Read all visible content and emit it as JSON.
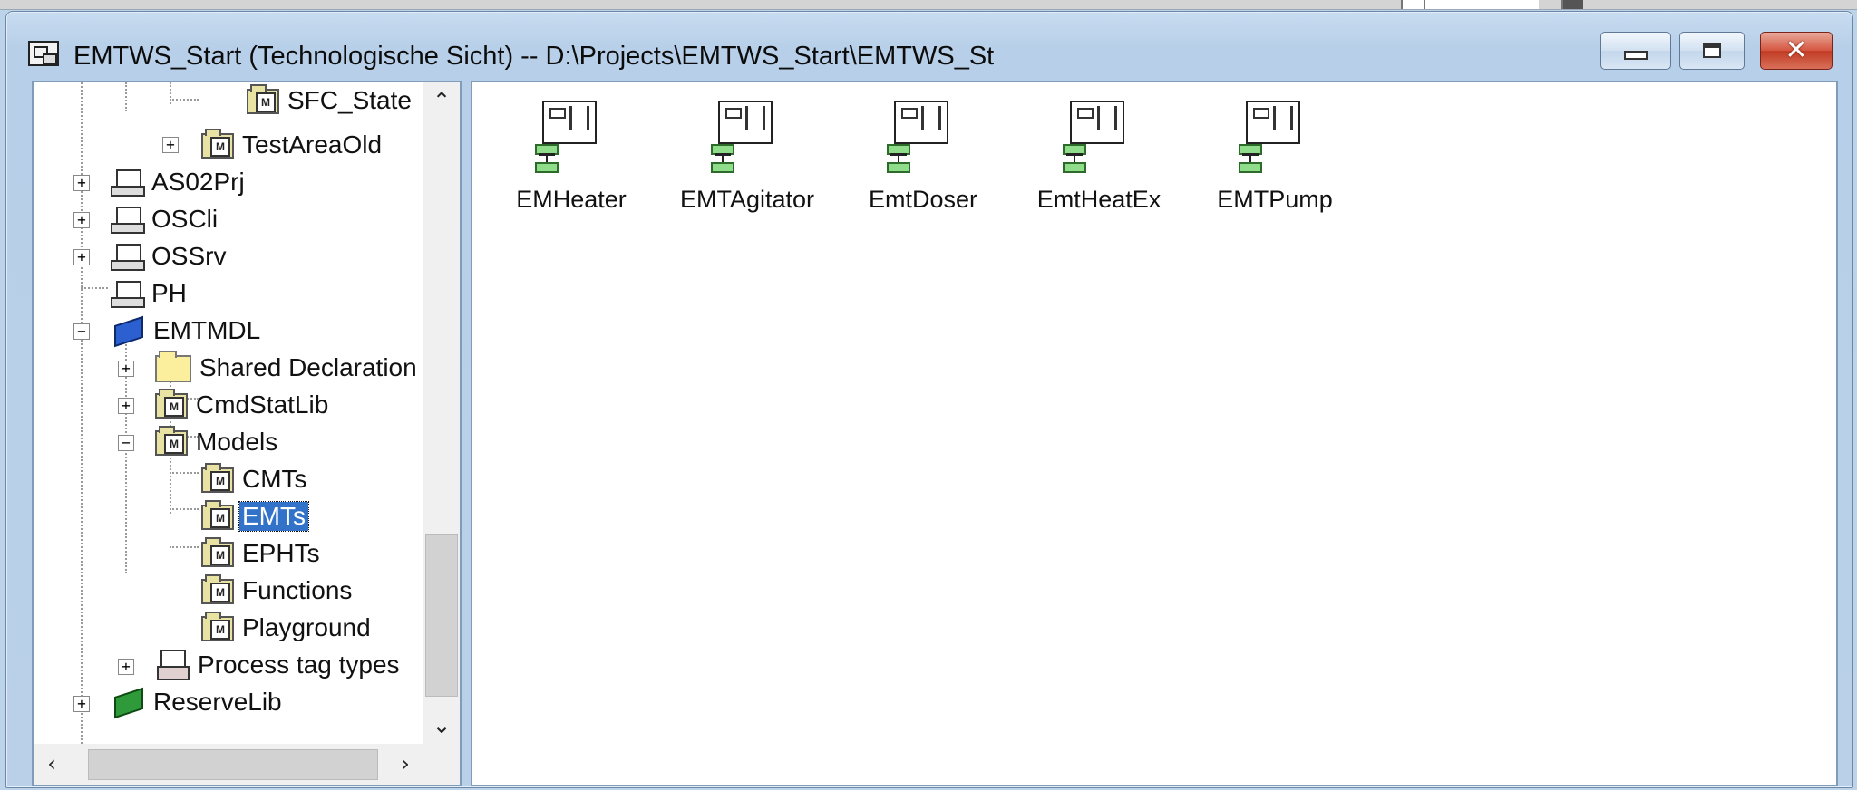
{
  "window": {
    "title": "EMTWS_Start (Technologische Sicht) -- D:\\Projects\\EMTWS_Start\\EMTWS_St"
  },
  "tree": {
    "items": [
      {
        "label": "SFC_State",
        "icon": "folder-model-icon"
      },
      {
        "label": "TestAreaOld",
        "icon": "folder-model-icon"
      },
      {
        "label": "AS02Prj",
        "icon": "computer-icon"
      },
      {
        "label": "OSCli",
        "icon": "computer-icon"
      },
      {
        "label": "OSSrv",
        "icon": "computer-icon"
      },
      {
        "label": "PH",
        "icon": "computer-icon"
      },
      {
        "label": "EMTMDL",
        "icon": "blue-library-icon"
      },
      {
        "label": "Shared Declaration",
        "icon": "folder-icon"
      },
      {
        "label": "CmdStatLib",
        "icon": "folder-model-icon"
      },
      {
        "label": "Models",
        "icon": "folder-model-icon"
      },
      {
        "label": "CMTs",
        "icon": "folder-model-icon"
      },
      {
        "label": "EMTs",
        "icon": "folder-model-icon",
        "selected": true
      },
      {
        "label": "EPHTs",
        "icon": "folder-model-icon"
      },
      {
        "label": "Functions",
        "icon": "folder-model-icon"
      },
      {
        "label": "Playground",
        "icon": "folder-model-icon"
      },
      {
        "label": "Process tag types",
        "icon": "process-tag-icon"
      },
      {
        "label": "ReserveLib",
        "icon": "green-library-icon"
      }
    ],
    "expander_plus": "+",
    "expander_minus": "−"
  },
  "content": {
    "items": [
      {
        "label": "EMHeater",
        "icon": "equipment-module-type-icon"
      },
      {
        "label": "EMTAgitator",
        "icon": "equipment-module-type-icon"
      },
      {
        "label": "EmtDoser",
        "icon": "equipment-module-type-icon"
      },
      {
        "label": "EmtHeatEx",
        "icon": "equipment-module-type-icon"
      },
      {
        "label": "EMTPump",
        "icon": "equipment-module-type-icon"
      }
    ]
  },
  "scroll": {
    "up": "⌃",
    "down": "⌄",
    "left": "‹",
    "right": "›"
  }
}
